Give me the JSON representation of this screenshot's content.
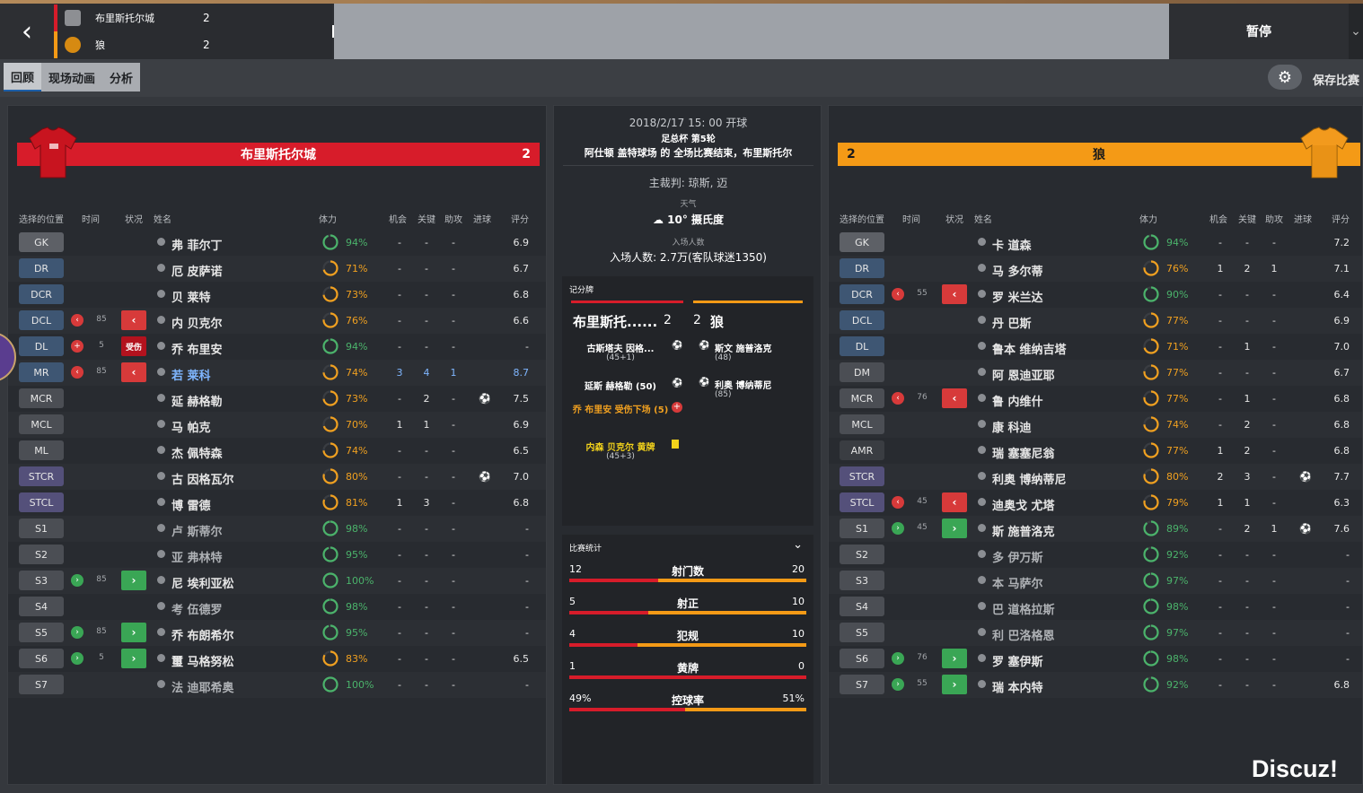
{
  "topbar": {
    "back_icon": "chevron-left-icon",
    "home": {
      "name": "布里斯托尔城",
      "score": "2",
      "color": "#d71c2a"
    },
    "away": {
      "name": "狼",
      "score": "2",
      "color": "#f49a16"
    },
    "pause_label": "暂停"
  },
  "subnav": {
    "tabs": [
      "回顾",
      "现场动画",
      "分析"
    ],
    "active_tab": "回顾",
    "save_label": "保存比赛"
  },
  "left_team": {
    "name": "布里斯托尔城",
    "score": "2",
    "headers": [
      "选择的位置",
      "时间",
      "状况",
      "姓名",
      "体力",
      "机会",
      "关键",
      "助攻",
      "进球",
      "评分"
    ],
    "players": [
      {
        "pos": "GK",
        "pos_color": "#5d6066",
        "name": "弗 菲尔丁",
        "cond": "94%",
        "ring": 94,
        "chances": "-",
        "key": "-",
        "assists": "-",
        "goal": "",
        "rating": "6.9"
      },
      {
        "pos": "DR",
        "pos_color": "#3e5673",
        "name": "厄 皮萨诺",
        "cond": "71%",
        "ring": 71,
        "chances": "-",
        "key": "-",
        "assists": "-",
        "goal": "",
        "rating": "6.7"
      },
      {
        "pos": "DCR",
        "pos_color": "#3e5673",
        "name": "贝 莱特",
        "cond": "73%",
        "ring": 73,
        "chances": "-",
        "key": "-",
        "assists": "-",
        "goal": "",
        "rating": "6.8"
      },
      {
        "pos": "DCL",
        "pos_color": "#3e5673",
        "sub": "out",
        "min": "85",
        "status": "out",
        "name": "内 贝克尔",
        "cond": "76%",
        "ring": 76,
        "chances": "-",
        "key": "-",
        "assists": "-",
        "goal": "",
        "rating": "6.6"
      },
      {
        "pos": "DL",
        "pos_color": "#3e5673",
        "sub": "injury",
        "min": "5",
        "status": "injury",
        "status_label": "受伤",
        "name": "乔 布里安",
        "cond": "94%",
        "ring": 94,
        "chances": "-",
        "key": "-",
        "assists": "-",
        "goal": "",
        "rating": "-"
      },
      {
        "pos": "MR",
        "pos_color": "#3e5673",
        "sub": "out",
        "min": "85",
        "status": "out",
        "name": "若 莱科",
        "highlight": true,
        "cond": "74%",
        "ring": 74,
        "chances": "3",
        "key": "4",
        "assists": "1",
        "goal": "",
        "rating": "8.7"
      },
      {
        "pos": "MCR",
        "pos_color": "#4b4e54",
        "name": "延 赫格勒",
        "cond": "73%",
        "ring": 73,
        "chances": "-",
        "key": "2",
        "assists": "-",
        "goal": "ball",
        "rating": "7.5"
      },
      {
        "pos": "MCL",
        "pos_color": "#4b4e54",
        "name": "马 帕克",
        "cond": "70%",
        "ring": 70,
        "chances": "1",
        "key": "1",
        "assists": "-",
        "goal": "",
        "rating": "6.9"
      },
      {
        "pos": "ML",
        "pos_color": "#4b4e54",
        "name": "杰 佩特森",
        "cond": "74%",
        "ring": 74,
        "chances": "-",
        "key": "-",
        "assists": "-",
        "goal": "",
        "rating": "6.5"
      },
      {
        "pos": "STCR",
        "pos_color": "#54507a",
        "name": "古 因格瓦尔",
        "cond": "80%",
        "ring": 80,
        "chances": "-",
        "key": "-",
        "assists": "-",
        "goal": "ball",
        "rating": "7.0"
      },
      {
        "pos": "STCL",
        "pos_color": "#54507a",
        "name": "博 雷德",
        "cond": "81%",
        "ring": 81,
        "chances": "1",
        "key": "3",
        "assists": "-",
        "goal": "",
        "rating": "6.8"
      },
      {
        "pos": "S1",
        "pos_color": "#4b4e54",
        "name": "卢 斯蒂尔",
        "dim": true,
        "cond": "98%",
        "ring": 98,
        "chances": "-",
        "key": "-",
        "assists": "-",
        "goal": "",
        "rating": "-"
      },
      {
        "pos": "S2",
        "pos_color": "#4b4e54",
        "name": "亚 弗林特",
        "dim": true,
        "cond": "95%",
        "ring": 95,
        "chances": "-",
        "key": "-",
        "assists": "-",
        "goal": "",
        "rating": "-"
      },
      {
        "pos": "S3",
        "pos_color": "#4b4e54",
        "sub": "in",
        "min": "85",
        "status": "in",
        "name": "尼 埃利亚松",
        "cond": "100%",
        "ring": 100,
        "chances": "-",
        "key": "-",
        "assists": "-",
        "goal": "",
        "rating": "-"
      },
      {
        "pos": "S4",
        "pos_color": "#4b4e54",
        "name": "考 伍德罗",
        "dim": true,
        "cond": "98%",
        "ring": 98,
        "chances": "-",
        "key": "-",
        "assists": "-",
        "goal": "",
        "rating": "-"
      },
      {
        "pos": "S5",
        "pos_color": "#4b4e54",
        "sub": "in",
        "min": "85",
        "status": "in",
        "name": "乔 布朗希尔",
        "cond": "95%",
        "ring": 95,
        "chances": "-",
        "key": "-",
        "assists": "-",
        "goal": "",
        "rating": "-"
      },
      {
        "pos": "S6",
        "pos_color": "#4b4e54",
        "sub": "in",
        "min": "5",
        "status": "in",
        "name": "璽 马格努松",
        "cond": "83%",
        "ring": 83,
        "chances": "-",
        "key": "-",
        "assists": "-",
        "goal": "",
        "rating": "6.5"
      },
      {
        "pos": "S7",
        "pos_color": "#4b4e54",
        "name": "法 迪耶希奥",
        "dim": true,
        "cond": "100%",
        "ring": 100,
        "chances": "-",
        "key": "-",
        "assists": "-",
        "goal": "",
        "rating": "-"
      }
    ]
  },
  "right_team": {
    "name": "狼",
    "score": "2",
    "headers": [
      "选择的位置",
      "时间",
      "状况",
      "姓名",
      "体力",
      "机会",
      "关键",
      "助攻",
      "进球",
      "评分"
    ],
    "players": [
      {
        "pos": "GK",
        "pos_color": "#5d6066",
        "name": "卡 道森",
        "cond": "94%",
        "ring": 94,
        "chances": "-",
        "key": "-",
        "assists": "-",
        "goal": "",
        "rating": "7.2"
      },
      {
        "pos": "DR",
        "pos_color": "#3e5673",
        "name": "马 多尔蒂",
        "cond": "76%",
        "ring": 76,
        "chances": "1",
        "key": "2",
        "assists": "1",
        "goal": "",
        "rating": "7.1"
      },
      {
        "pos": "DCR",
        "pos_color": "#3e5673",
        "sub": "out",
        "min": "55",
        "status": "out",
        "name": "罗 米兰达",
        "cond": "90%",
        "ring": 90,
        "chances": "-",
        "key": "-",
        "assists": "-",
        "goal": "",
        "rating": "6.4"
      },
      {
        "pos": "DCL",
        "pos_color": "#3e5673",
        "name": "丹 巴斯",
        "cond": "77%",
        "ring": 77,
        "chances": "-",
        "key": "-",
        "assists": "-",
        "goal": "",
        "rating": "6.9"
      },
      {
        "pos": "DL",
        "pos_color": "#3e5673",
        "name": "鲁本 维纳吉塔",
        "cond": "71%",
        "ring": 71,
        "chances": "-",
        "key": "1",
        "assists": "-",
        "goal": "",
        "rating": "7.0"
      },
      {
        "pos": "DM",
        "pos_color": "#4b4e54",
        "name": "阿 恩迪亚耶",
        "cond": "77%",
        "ring": 77,
        "chances": "-",
        "key": "-",
        "assists": "-",
        "goal": "",
        "rating": "6.7"
      },
      {
        "pos": "MCR",
        "pos_color": "#4b4e54",
        "sub": "out",
        "min": "76",
        "status": "out",
        "name": "鲁 内维什",
        "cond": "77%",
        "ring": 77,
        "chances": "-",
        "key": "1",
        "assists": "-",
        "goal": "",
        "rating": "6.8"
      },
      {
        "pos": "MCL",
        "pos_color": "#4b4e54",
        "name": "康 科迪",
        "cond": "74%",
        "ring": 74,
        "chances": "-",
        "key": "2",
        "assists": "-",
        "goal": "",
        "rating": "6.8"
      },
      {
        "pos": "AMR",
        "pos_color": "#3a3d42",
        "name": "瑞 塞塞尼翁",
        "cond": "77%",
        "ring": 77,
        "chances": "1",
        "key": "2",
        "assists": "-",
        "goal": "",
        "rating": "6.8"
      },
      {
        "pos": "STCR",
        "pos_color": "#54507a",
        "name": "利奥 博纳蒂尼",
        "cond": "80%",
        "ring": 80,
        "chances": "2",
        "key": "3",
        "assists": "-",
        "goal": "ball",
        "rating": "7.7"
      },
      {
        "pos": "STCL",
        "pos_color": "#54507a",
        "sub": "out",
        "min": "45",
        "status": "out",
        "name": "迪奥戈 尤塔",
        "cond": "79%",
        "ring": 79,
        "chances": "1",
        "key": "1",
        "assists": "-",
        "goal": "",
        "rating": "6.3"
      },
      {
        "pos": "S1",
        "pos_color": "#4b4e54",
        "sub": "in",
        "min": "45",
        "status": "in",
        "name": "斯 施普洛克",
        "cond": "89%",
        "ring": 89,
        "chances": "-",
        "key": "2",
        "assists": "1",
        "goal": "ball",
        "rating": "7.6"
      },
      {
        "pos": "S2",
        "pos_color": "#4b4e54",
        "name": "多 伊万斯",
        "dim": true,
        "cond": "92%",
        "ring": 92,
        "chances": "-",
        "key": "-",
        "assists": "-",
        "goal": "",
        "rating": "-"
      },
      {
        "pos": "S3",
        "pos_color": "#4b4e54",
        "name": "本 马萨尔",
        "dim": true,
        "cond": "97%",
        "ring": 97,
        "chances": "-",
        "key": "-",
        "assists": "-",
        "goal": "",
        "rating": "-"
      },
      {
        "pos": "S4",
        "pos_color": "#4b4e54",
        "name": "巴 道格拉斯",
        "dim": true,
        "cond": "98%",
        "ring": 98,
        "chances": "-",
        "key": "-",
        "assists": "-",
        "goal": "",
        "rating": "-"
      },
      {
        "pos": "S5",
        "pos_color": "#4b4e54",
        "name": "利 巴洛格恩",
        "dim": true,
        "cond": "97%",
        "ring": 97,
        "chances": "-",
        "key": "-",
        "assists": "-",
        "goal": "",
        "rating": "-"
      },
      {
        "pos": "S6",
        "pos_color": "#4b4e54",
        "sub": "in",
        "min": "76",
        "status": "in",
        "name": "罗 塞伊斯",
        "cond": "98%",
        "ring": 98,
        "chances": "-",
        "key": "-",
        "assists": "-",
        "goal": "",
        "rating": "-"
      },
      {
        "pos": "S7",
        "pos_color": "#4b4e54",
        "sub": "in",
        "min": "55",
        "status": "in",
        "name": "瑞 本内特",
        "cond": "92%",
        "ring": 92,
        "chances": "-",
        "key": "-",
        "assists": "-",
        "goal": "",
        "rating": "6.8"
      }
    ]
  },
  "center": {
    "datetime": "2018/2/17 15: 00 开球",
    "competition": "足总杯 第5轮",
    "venue_line": "阿仕顿 盖特球场 的 全场比赛结束，布里斯托尔",
    "referee": "主裁判: 琼斯, 迈",
    "weather_label": "天气",
    "weather_value": "10° 摄氏度",
    "attendance_label": "入场人数",
    "attendance_value": "入场人数: 2.7万(客队球迷1350)",
    "scoreboard": {
      "title": "记分牌",
      "home_short": "布里斯托......",
      "home_score": "2",
      "away_score": "2",
      "away_name": "狼",
      "home_events": [
        {
          "text": "古斯塔夫 因格...",
          "sub": "(45+1)",
          "type": "goal"
        },
        {
          "text": "延斯 赫格勒 (50)",
          "sub": "",
          "type": "goal"
        },
        {
          "text": "乔 布里安 受伤下场 (5)",
          "sub": "",
          "type": "injury"
        },
        {
          "text": "内森 贝克尔 黄牌",
          "sub": "(45+3)",
          "type": "yellow"
        }
      ],
      "away_events": [
        {
          "text": "斯文 施普洛克",
          "sub": "(48)",
          "type": "goal"
        },
        {
          "text": "利奥 博纳蒂尼",
          "sub": "(85)",
          "type": "goal"
        }
      ]
    },
    "stats": {
      "title": "比赛统计",
      "rows": [
        {
          "label": "射门数",
          "home": "12",
          "away": "20",
          "home_frac": 0.375
        },
        {
          "label": "射正",
          "home": "5",
          "away": "10",
          "home_frac": 0.333
        },
        {
          "label": "犯规",
          "home": "4",
          "away": "10",
          "home_frac": 0.286
        },
        {
          "label": "黄牌",
          "home": "1",
          "away": "0",
          "home_frac": 1.0
        },
        {
          "label": "控球率",
          "home": "49%",
          "away": "51%",
          "home_frac": 0.49
        }
      ]
    }
  },
  "watermark": "Discuz!",
  "colors": {
    "home": "#d71c2a",
    "away": "#f49a16",
    "green": "#3aa655",
    "red": "#d73a3a",
    "cond_green": "#4bb36b",
    "cond_orange": "#f0a020"
  }
}
